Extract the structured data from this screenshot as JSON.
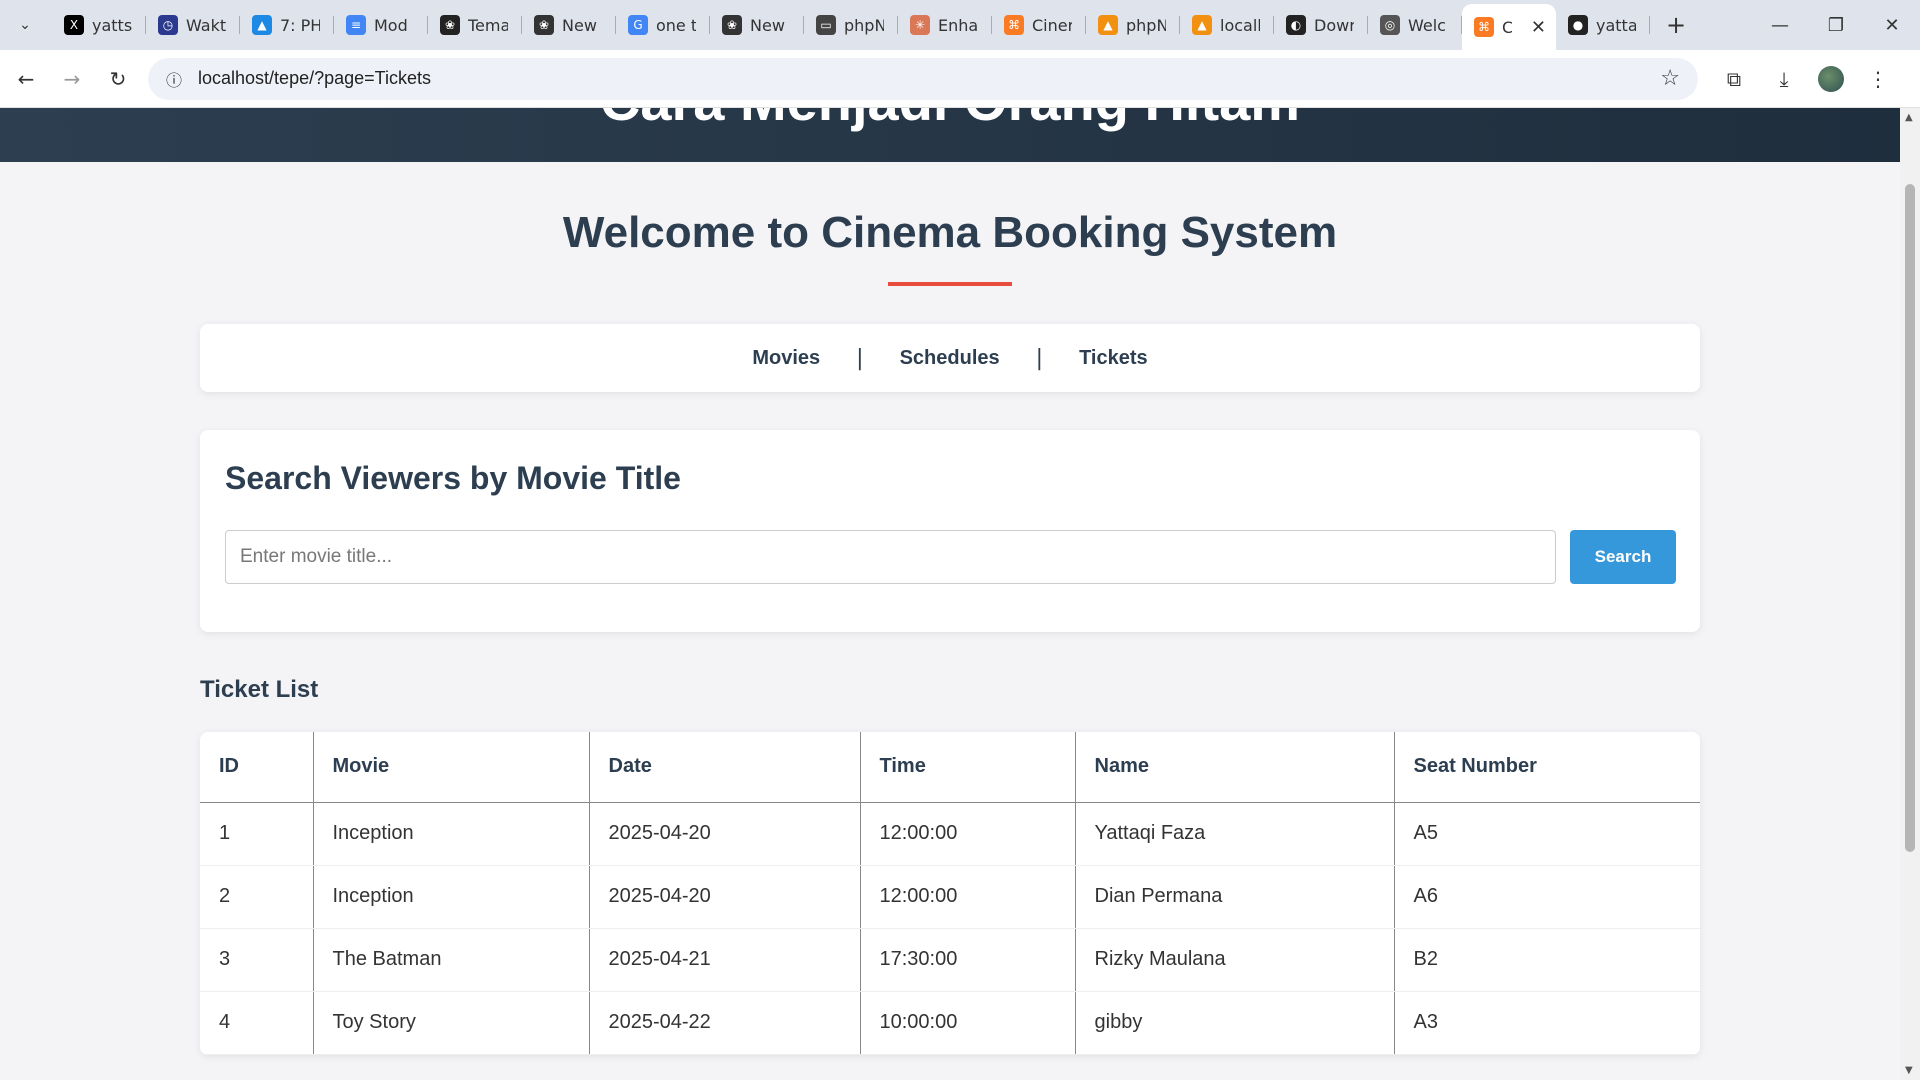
{
  "browser": {
    "tabs": [
      {
        "label": "yatts",
        "icon": "x-logo-icon",
        "color": "#000000"
      },
      {
        "label": "Wakt",
        "icon": "clock-icon",
        "color": "#2b3a8f"
      },
      {
        "label": "7: PH",
        "icon": "drive-icon",
        "color": "#1e88e5"
      },
      {
        "label": "Mod",
        "icon": "docs-icon",
        "color": "#4285f4"
      },
      {
        "label": "Tema",
        "icon": "openai-icon",
        "color": "#222222"
      },
      {
        "label": "New",
        "icon": "chatgpt-icon",
        "color": "#333333"
      },
      {
        "label": "one t",
        "icon": "google-icon",
        "color": "#4285f4"
      },
      {
        "label": "New",
        "icon": "chatgpt-icon",
        "color": "#333333"
      },
      {
        "label": "phpN",
        "icon": "laptop-icon",
        "color": "#444444"
      },
      {
        "label": "Enha",
        "icon": "claude-icon",
        "color": "#d97757"
      },
      {
        "label": "Ciner",
        "icon": "xampp-icon",
        "color": "#fb7a24"
      },
      {
        "label": "phpN",
        "icon": "phpmyadmin-icon",
        "color": "#f29111"
      },
      {
        "label": "locall",
        "icon": "phpmyadmin-icon",
        "color": "#f29111"
      },
      {
        "label": "Dowr",
        "icon": "download-site-icon",
        "color": "#222222"
      },
      {
        "label": "Welc",
        "icon": "globe-icon",
        "color": "#555555"
      },
      {
        "label": "C",
        "icon": "xampp-icon",
        "color": "#fb7a24",
        "active": true
      },
      {
        "label": "yatta",
        "icon": "github-icon",
        "color": "#222222"
      }
    ],
    "url": "localhost/tepe/?page=Tickets"
  },
  "hero": {
    "title": "Cara Menjadi Orang Hitam"
  },
  "page": {
    "welcome": "Welcome to Cinema Booking System",
    "accent_color": "#e74c3c",
    "nav": {
      "movies": "Movies",
      "schedules": "Schedules",
      "tickets": "Tickets",
      "separator": "|"
    },
    "search": {
      "title": "Search Viewers by Movie Title",
      "placeholder": "Enter movie title...",
      "button": "Search",
      "button_color": "#3498db"
    },
    "list_title": "Ticket List",
    "table": {
      "headers": [
        "ID",
        "Movie",
        "Date",
        "Time",
        "Name",
        "Seat Number"
      ],
      "rows": [
        [
          "1",
          "Inception",
          "2025-04-20",
          "12:00:00",
          "Yattaqi Faza",
          "A5"
        ],
        [
          "2",
          "Inception",
          "2025-04-20",
          "12:00:00",
          "Dian Permana",
          "A6"
        ],
        [
          "3",
          "The Batman",
          "2025-04-21",
          "17:30:00",
          "Rizky Maulana",
          "B2"
        ],
        [
          "4",
          "Toy Story",
          "2025-04-22",
          "10:00:00",
          "gibby",
          "A3"
        ]
      ]
    }
  }
}
